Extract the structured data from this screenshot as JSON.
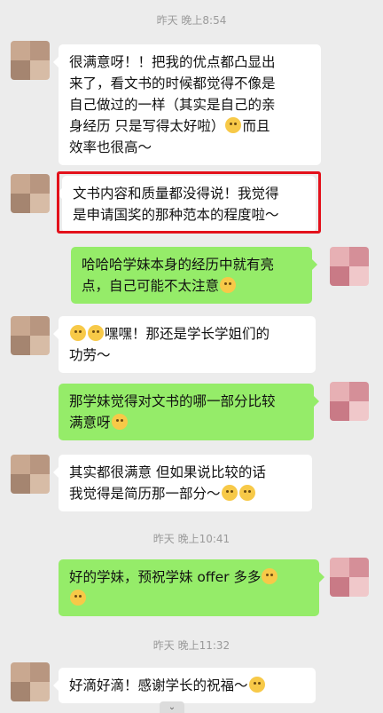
{
  "timestamps": {
    "t1": "昨天 晚上8:54",
    "t2": "昨天 晚上10:41",
    "t3": "昨天 晚上11:32"
  },
  "messages": {
    "m1": [
      "很满意呀！！把我的优点都凸显出",
      "来了，看文书的时候都觉得不像是",
      "自己做过的一样（其实是自己的亲",
      "身经历 只是写得太好啦）",
      "而且",
      "效率也很高～"
    ],
    "m2": [
      "文书内容和质量都没得说！我觉得",
      "是申请国奖的那种范本的程度啦～"
    ],
    "m3": [
      "哈哈哈学妹本身的经历中就有亮",
      "点，自己可能不太注意"
    ],
    "m4": [
      "嘿嘿！那还是学长学姐们的",
      "功劳～"
    ],
    "m5": [
      "那学妹觉得对文书的哪一部分比较",
      "满意呀"
    ],
    "m6": [
      "其实都很满意 但如果说比较的话",
      "我觉得是简历那一部分～"
    ],
    "m7": [
      "好的学妹，预祝学妹 offer 多多"
    ],
    "m8": [
      "好滴好滴！感谢学长的祝福～"
    ]
  },
  "icons": {
    "scroll": "chevron-down-icon"
  },
  "colors": {
    "incoming_bubble": "#ffffff",
    "outgoing_bubble": "#95ec69",
    "highlight_box": "#e3111b",
    "background": "#ececec"
  }
}
